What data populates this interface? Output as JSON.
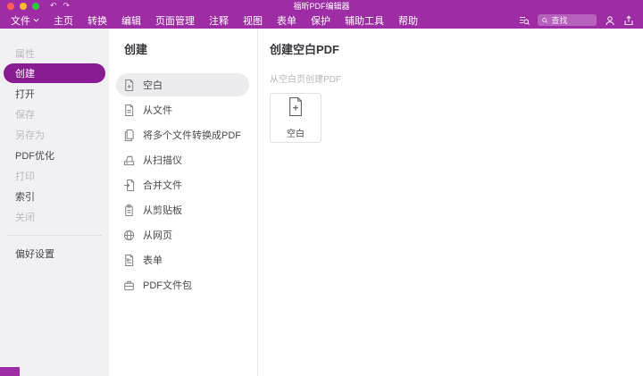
{
  "window": {
    "title": "福昕PDF编辑器"
  },
  "menu": {
    "items": [
      {
        "label": "文件",
        "has_caret": true
      },
      {
        "label": "主页"
      },
      {
        "label": "转换"
      },
      {
        "label": "编辑"
      },
      {
        "label": "页面管理"
      },
      {
        "label": "注释"
      },
      {
        "label": "视图"
      },
      {
        "label": "表单"
      },
      {
        "label": "保护"
      },
      {
        "label": "辅助工具"
      },
      {
        "label": "帮助"
      }
    ],
    "search_placeholder": "查找",
    "right_icons": [
      "advanced-search-icon",
      "user-icon",
      "share-icon"
    ]
  },
  "sidebar": {
    "items": [
      {
        "label": "属性",
        "state": "disabled"
      },
      {
        "label": "创建",
        "state": "selected"
      },
      {
        "label": "打开",
        "state": "normal"
      },
      {
        "label": "保存",
        "state": "disabled"
      },
      {
        "label": "另存为",
        "state": "disabled"
      },
      {
        "label": "PDF优化",
        "state": "normal"
      },
      {
        "label": "打印",
        "state": "disabled"
      },
      {
        "label": "索引",
        "state": "normal"
      },
      {
        "label": "关闭",
        "state": "disabled"
      }
    ],
    "footer_item": {
      "label": "偏好设置"
    }
  },
  "create_panel": {
    "title": "创建",
    "items": [
      {
        "label": "空白",
        "icon": "blank-doc-icon",
        "selected": true
      },
      {
        "label": "从文件",
        "icon": "from-file-icon"
      },
      {
        "label": "将多个文件转换成PDF",
        "icon": "multiple-files-icon"
      },
      {
        "label": "从扫描仪",
        "icon": "scanner-icon"
      },
      {
        "label": "合并文件",
        "icon": "combine-files-icon"
      },
      {
        "label": "从剪贴板",
        "icon": "clipboard-icon"
      },
      {
        "label": "从网页",
        "icon": "web-page-icon"
      },
      {
        "label": "表单",
        "icon": "form-icon"
      },
      {
        "label": "PDF文件包",
        "icon": "portfolio-icon"
      }
    ]
  },
  "detail_panel": {
    "title": "创建空白PDF",
    "subtitle": "从空白页创建PDF",
    "card": {
      "label": "空白",
      "icon": "new-blank-doc-plus-icon"
    }
  },
  "colors": {
    "titlebar": "#9e2ca4",
    "selected_pill": "#8a1c92",
    "selected_list_row": "#ececee",
    "sidebar_bg": "#f1f0f2"
  }
}
